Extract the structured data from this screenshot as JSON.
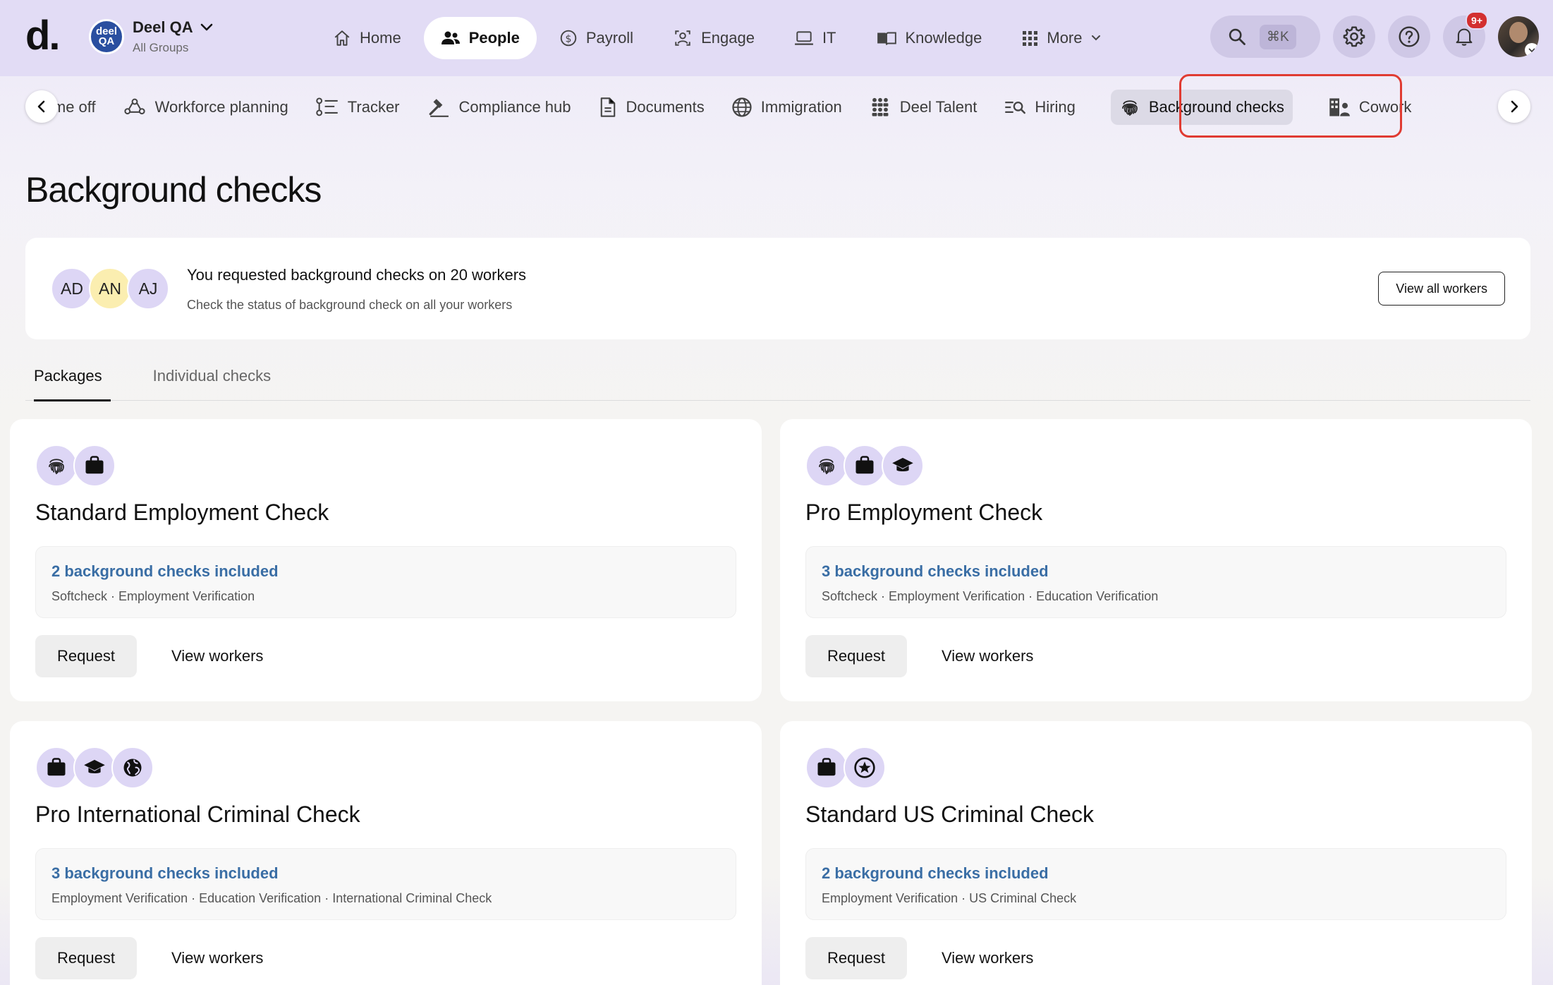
{
  "topbar": {
    "logo": "d.",
    "org": {
      "avatar_line1": "deel",
      "avatar_line2": "QA",
      "name": "Deel QA",
      "sub": "All Groups"
    },
    "nav": [
      {
        "label": "Home",
        "icon": "home-icon"
      },
      {
        "label": "People",
        "icon": "people-icon",
        "active": true
      },
      {
        "label": "Payroll",
        "icon": "dollar-icon"
      },
      {
        "label": "Engage",
        "icon": "engage-icon"
      },
      {
        "label": "IT",
        "icon": "laptop-icon"
      },
      {
        "label": "Knowledge",
        "icon": "book-icon"
      },
      {
        "label": "More",
        "icon": "grid-icon"
      }
    ],
    "search_shortcut": "⌘K",
    "notification_count": "9+"
  },
  "subnav": {
    "items": [
      {
        "label": "ime off",
        "icon": "time-off-icon"
      },
      {
        "label": "Workforce planning",
        "icon": "workforce-planning-icon"
      },
      {
        "label": "Tracker",
        "icon": "tracker-icon"
      },
      {
        "label": "Compliance hub",
        "icon": "gavel-icon"
      },
      {
        "label": "Documents",
        "icon": "document-icon"
      },
      {
        "label": "Immigration",
        "icon": "globe-icon"
      },
      {
        "label": "Deel Talent",
        "icon": "talent-icon"
      },
      {
        "label": "Hiring",
        "icon": "hiring-icon"
      },
      {
        "label": "Background checks",
        "icon": "fingerprint-icon",
        "active": true
      },
      {
        "label": "Cowork",
        "icon": "building-icon"
      }
    ]
  },
  "page": {
    "title": "Background checks"
  },
  "summary": {
    "avatars": [
      {
        "initials": "AD",
        "color": "#ddd6f5"
      },
      {
        "initials": "AN",
        "color": "#fbeeb0"
      },
      {
        "initials": "AJ",
        "color": "#ddd6f5"
      }
    ],
    "title": "You requested background checks on 20 workers",
    "subtitle": "Check the status of background check on all your workers",
    "button": "View all workers"
  },
  "tabs": [
    {
      "label": "Packages",
      "active": true
    },
    {
      "label": "Individual checks"
    }
  ],
  "packages": [
    {
      "icons": [
        "fingerprint-icon",
        "briefcase-icon"
      ],
      "title": "Standard Employment Check",
      "count": "2 background checks included",
      "checks": "Softcheck · Employment Verification",
      "request": "Request",
      "view": "View workers"
    },
    {
      "icons": [
        "fingerprint-icon",
        "briefcase-icon",
        "graduation-cap-icon"
      ],
      "title": "Pro Employment Check",
      "count": "3 background checks included",
      "checks": "Softcheck · Employment Verification · Education Verification",
      "request": "Request",
      "view": "View workers"
    },
    {
      "icons": [
        "briefcase-icon",
        "graduation-cap-icon",
        "globe-icon"
      ],
      "title": "Pro International Criminal Check",
      "count": "3 background checks included",
      "checks": "Employment Verification · Education Verification · International Criminal Check",
      "request": "Request",
      "view": "View workers"
    },
    {
      "icons": [
        "briefcase-icon",
        "star-badge-icon"
      ],
      "title": "Standard US Criminal Check",
      "count": "2 background checks included",
      "checks": "Employment Verification · US Criminal Check",
      "request": "Request",
      "view": "View workers"
    }
  ],
  "colors": {
    "topbar_bg": "#e2dcf5",
    "accent_link": "#3a6ea5",
    "highlight": "#e03b32",
    "icon_circle": "#ddd6f5"
  }
}
